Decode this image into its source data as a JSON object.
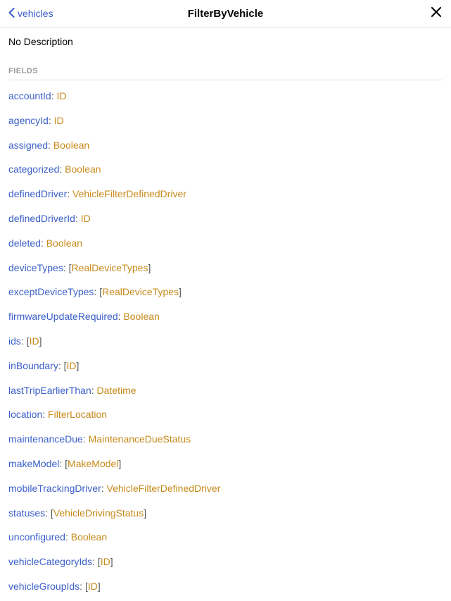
{
  "header": {
    "back_label": "vehicles",
    "title": "FilterByVehicle"
  },
  "description": "No Description",
  "section_label": "FIELDS",
  "fields": [
    {
      "name": "accountId",
      "type": "ID",
      "list": false
    },
    {
      "name": "agencyId",
      "type": "ID",
      "list": false
    },
    {
      "name": "assigned",
      "type": "Boolean",
      "list": false
    },
    {
      "name": "categorized",
      "type": "Boolean",
      "list": false
    },
    {
      "name": "definedDriver",
      "type": "VehicleFilterDefinedDriver",
      "list": false
    },
    {
      "name": "definedDriverId",
      "type": "ID",
      "list": false
    },
    {
      "name": "deleted",
      "type": "Boolean",
      "list": false
    },
    {
      "name": "deviceTypes",
      "type": "RealDeviceTypes",
      "list": true
    },
    {
      "name": "exceptDeviceTypes",
      "type": "RealDeviceTypes",
      "list": true
    },
    {
      "name": "firmwareUpdateRequired",
      "type": "Boolean",
      "list": false
    },
    {
      "name": "ids",
      "type": "ID",
      "list": true
    },
    {
      "name": "inBoundary",
      "type": "ID",
      "list": true
    },
    {
      "name": "lastTripEarlierThan",
      "type": "Datetime",
      "list": false
    },
    {
      "name": "location",
      "type": "FilterLocation",
      "list": false
    },
    {
      "name": "maintenanceDue",
      "type": "MaintenanceDueStatus",
      "list": false
    },
    {
      "name": "makeModel",
      "type": "MakeModel",
      "list": true
    },
    {
      "name": "mobileTrackingDriver",
      "type": "VehicleFilterDefinedDriver",
      "list": false
    },
    {
      "name": "statuses",
      "type": "VehicleDrivingStatus",
      "list": true
    },
    {
      "name": "unconfigured",
      "type": "Boolean",
      "list": false
    },
    {
      "name": "vehicleCategoryIds",
      "type": "ID",
      "list": true
    },
    {
      "name": "vehicleGroupIds",
      "type": "ID",
      "list": true
    }
  ]
}
